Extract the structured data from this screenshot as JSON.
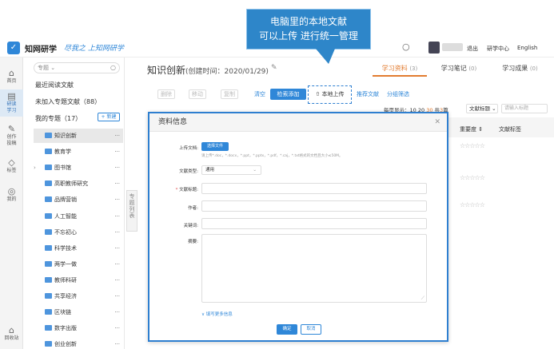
{
  "callout": {
    "line1": "电脑里的本地文献",
    "line2": "可以上传 进行统一管理"
  },
  "header": {
    "app_title": "知网研学",
    "slogan": "尽我之 上知网研学",
    "logout": "退出",
    "study_center": "研学中心",
    "language": "English"
  },
  "nav": [
    {
      "label": "首页",
      "icon": "⌂"
    },
    {
      "label": "研读学习",
      "icon": "▤"
    },
    {
      "label": "创作投稿",
      "icon": "✎"
    },
    {
      "label": "标签",
      "icon": "⌂"
    },
    {
      "label": "我的",
      "icon": "◎"
    },
    {
      "label": "回收站",
      "icon": "🗑"
    }
  ],
  "left_panel": {
    "topic_placeholder": "专题 ⌄",
    "recent": "最近阅读文献",
    "unsorted": "未加入专题文献（88）",
    "my_topics": "我的专题（17）",
    "new_button": "+ 新建",
    "folders": [
      "知识创新",
      "教育学",
      "图书馆",
      "高职教师研究",
      "品牌营销",
      "人工智能",
      "不忘初心",
      "科学技术",
      "两学一做",
      "教师科研",
      "共享经济",
      "区块链",
      "数字出版",
      "创业创新"
    ]
  },
  "side_tab": "专题列表",
  "main": {
    "title": "知识创新",
    "created": "(创建时间：2020/01/29)",
    "tabs": [
      {
        "label": "学习资料",
        "count": "(3)"
      },
      {
        "label": "学习笔记",
        "count": "(0)"
      },
      {
        "label": "学习成果",
        "count": "(0)"
      }
    ],
    "toolbar": {
      "delete": "删除",
      "move": "移动",
      "copy": "复制",
      "clear": "清空",
      "search_add": "检索添加",
      "local_upload": "本地上传",
      "recommend": "推荐文献",
      "group_filter": "分组筛选"
    },
    "pager": {
      "prefix": "每页显示：10  20 ",
      "active": "30",
      "total_prefix": "  共",
      "total": "3",
      "total_suffix": "篇"
    },
    "sort_select": "文献标题 ⌄",
    "name_placeholder": "请输入标题",
    "columns": {
      "importance": "重要度 ⇕",
      "tags": "文献标签"
    },
    "stars": "☆☆☆☆☆"
  },
  "dialog": {
    "title": "资料信息",
    "close": "✕",
    "upload_label": "上传文档:",
    "choose_file": "选择文件",
    "file_hint": "请上传*.doc，*.docx，*.ppt，*.pptx，*.pdf，*.caj，*.txt格式的文档且大小≤50M。",
    "doc_type_label": "文献类型:",
    "doc_type_value": "通用",
    "title_label": "文献标题:",
    "author_label": "作者:",
    "keyword_label": "关键词:",
    "abstract_label": "摘要:",
    "more_info": "∨ 填写更多信息",
    "ok": "确定",
    "cancel": "取消"
  }
}
